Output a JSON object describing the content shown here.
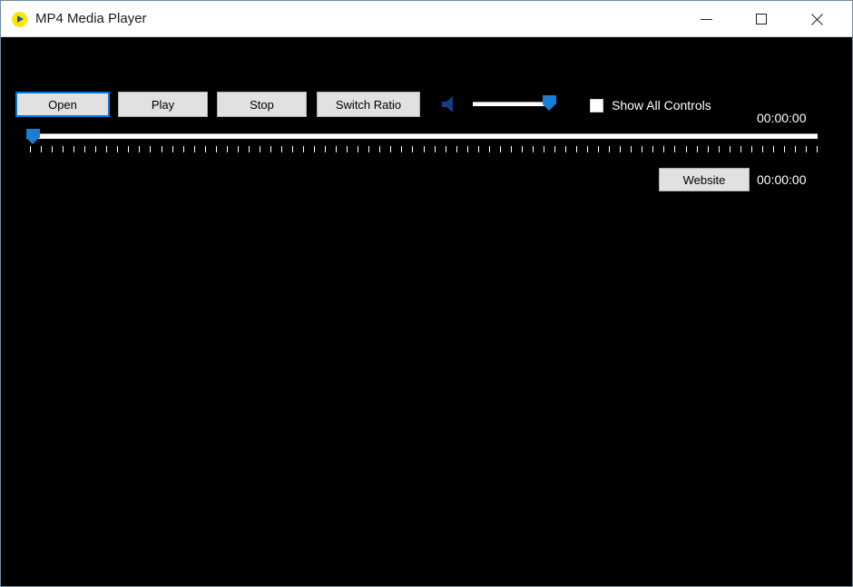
{
  "window": {
    "title": "MP4 Media Player",
    "app_icon": "play-circle-icon",
    "border_color": "#6f8ea3",
    "titlebar_bg": "#ffffff",
    "content_bg": "#000000",
    "accent_color": "#0078d7",
    "slider_thumb_color": "#1a7fd4",
    "speaker_icon_color": "#1b3a84"
  },
  "titlebar_controls": {
    "minimize": {
      "name": "minimize-button",
      "glyph": "minimize-icon"
    },
    "maximize": {
      "name": "maximize-button",
      "glyph": "maximize-icon"
    },
    "close": {
      "name": "close-button",
      "glyph": "close-icon"
    }
  },
  "toolbar": {
    "open_label": "Open",
    "play_label": "Play",
    "stop_label": "Stop",
    "switch_ratio_label": "Switch Ratio",
    "open_focused": true
  },
  "volume": {
    "icon": "speaker-icon",
    "value": 100,
    "min": 0,
    "max": 100,
    "thumb_position_pct": 100
  },
  "show_all_controls": {
    "label": "Show All Controls",
    "checked": false
  },
  "timestamps": {
    "elapsed": "00:00:00",
    "duration": "00:00:00"
  },
  "seek": {
    "value": 0,
    "min": 0,
    "max": 100,
    "thumb_position_pct": 0,
    "tick_count": 73
  },
  "footer": {
    "website_label": "Website"
  }
}
